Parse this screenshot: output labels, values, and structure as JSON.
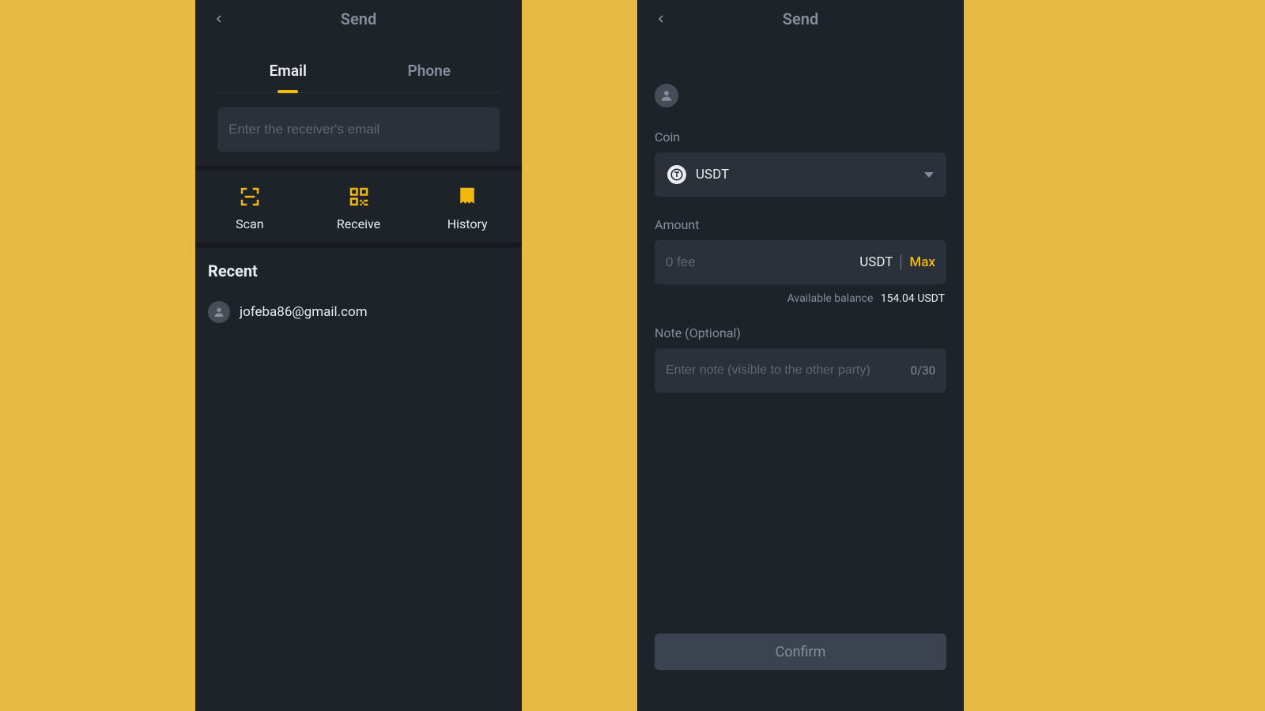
{
  "colors": {
    "accent": "#f0b90b",
    "bg": "#1e2329",
    "page": "#e6b940"
  },
  "left": {
    "header": {
      "title": "Send"
    },
    "tabs": {
      "email": "Email",
      "phone": "Phone",
      "active": "email"
    },
    "search": {
      "placeholder": "Enter the receiver's email",
      "value": ""
    },
    "actions": {
      "scan": "Scan",
      "receive": "Receive",
      "history": "History"
    },
    "recent": {
      "title": "Recent",
      "items": [
        {
          "email": "jofeba86@gmail.com"
        }
      ]
    }
  },
  "right": {
    "header": {
      "title": "Send"
    },
    "coin": {
      "label": "Coin",
      "selected": "USDT"
    },
    "amount": {
      "label": "Amount",
      "placeholder": "0 fee",
      "value": "",
      "unit": "USDT",
      "max": "Max"
    },
    "balance": {
      "label": "Available balance",
      "value": "154.04 USDT"
    },
    "note": {
      "label": "Note (Optional)",
      "placeholder": "Enter note (visible to the other party)",
      "count": "0/30",
      "value": ""
    },
    "confirm": "Confirm"
  }
}
